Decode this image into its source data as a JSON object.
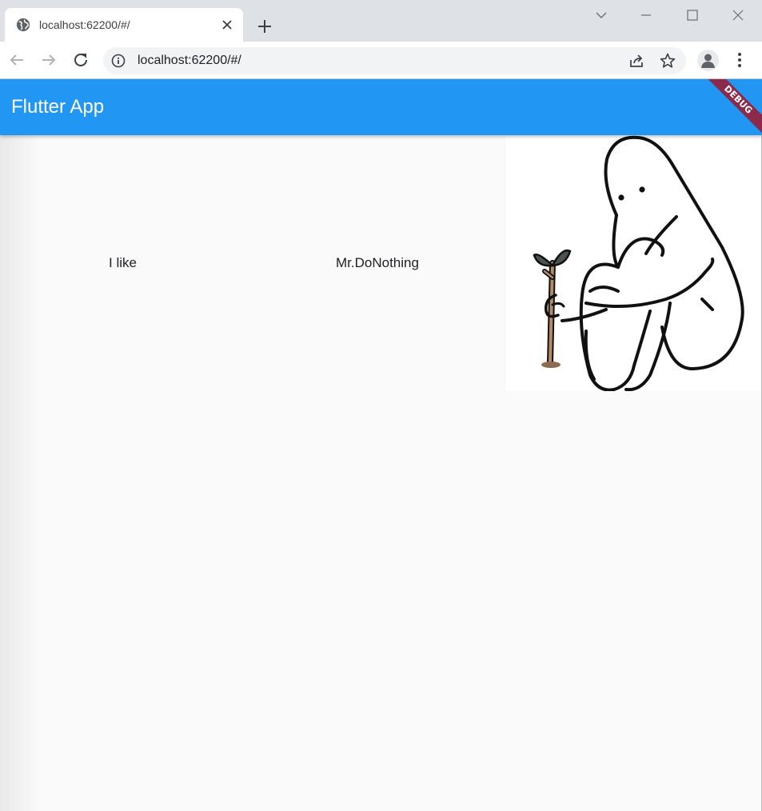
{
  "browser": {
    "tab": {
      "title": "localhost:62200/#/",
      "favicon": "globe-icon"
    },
    "address": {
      "url": "localhost:62200/#/"
    }
  },
  "app": {
    "title": "Flutter App",
    "debug_banner": "DEBUG",
    "appbar_color": "#2196f3",
    "row": {
      "first_text": "I like",
      "second_text": "Mr.DoNothing",
      "image": "cartoon-character-holding-sprout"
    }
  }
}
